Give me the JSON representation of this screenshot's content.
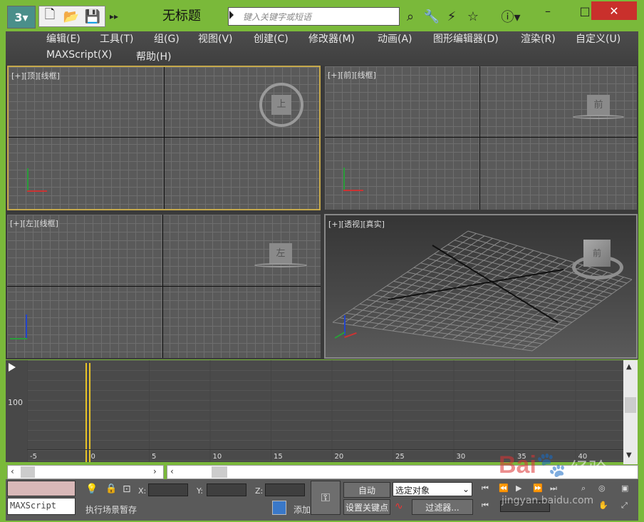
{
  "window": {
    "title": "无标题",
    "search_placeholder": "键入关键字或短语",
    "colors": {
      "chrome": "#7ab93a",
      "viewport_bg": "#5a5a5a",
      "active_border": "#d6b84a",
      "time_slider": "#e8c428"
    }
  },
  "menus": [
    "编辑(E)",
    "工具(T)",
    "组(G)",
    "视图(V)",
    "创建(C)",
    "修改器(M)",
    "动画(A)",
    "图形编辑器(D)",
    "渲染(R)",
    "自定义(U)",
    "MAXScript(X)",
    "帮助(H)"
  ],
  "viewports": [
    {
      "label": "[+][顶][线框]",
      "cube": "上"
    },
    {
      "label": "[+][前][线框]",
      "cube": "前"
    },
    {
      "label": "[+][左][线框]",
      "cube": "左"
    },
    {
      "label": "[+][透视][真实]",
      "cube": "前"
    }
  ],
  "timeline": {
    "y_value": "100",
    "ticks": [
      "-5",
      "0",
      "5",
      "10",
      "15",
      "20",
      "25",
      "30",
      "35",
      "40"
    ]
  },
  "status": {
    "maxscript_label": "MAXScript",
    "status_text": "执行场景暂存",
    "add_label": "添加",
    "x_label": "X:",
    "y_label": "Y:",
    "z_label": "Z:",
    "auto_label": "自动",
    "set_key_label": "设置关键点",
    "selection_value": "选定对象",
    "filter_label": "过滤器..."
  },
  "watermark": "jingyan.baidu.com"
}
